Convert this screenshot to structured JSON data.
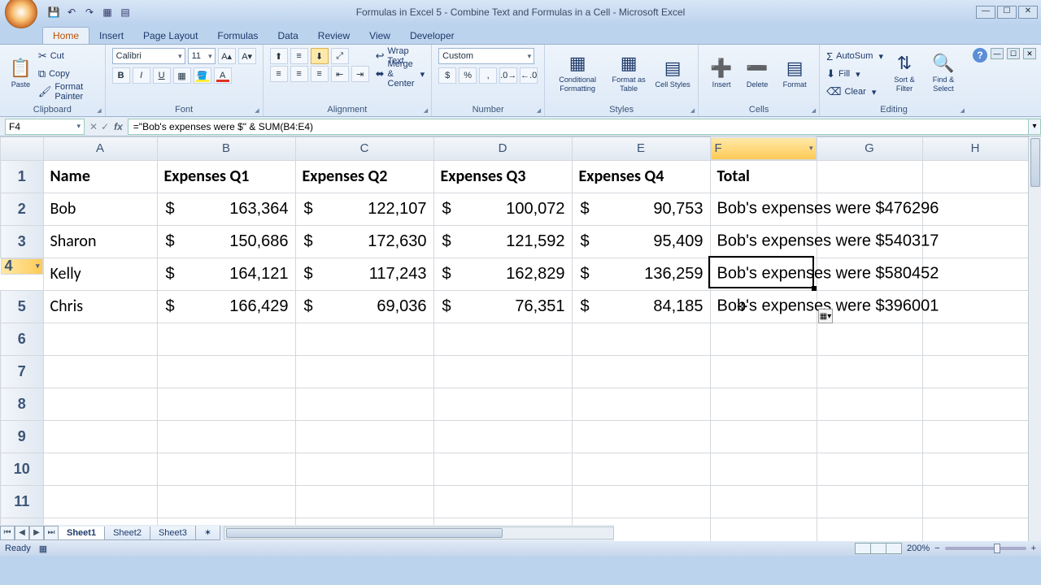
{
  "window": {
    "title": "Formulas in Excel 5 - Combine Text and Formulas in a Cell - Microsoft Excel"
  },
  "tabs": {
    "t0": "Home",
    "t1": "Insert",
    "t2": "Page Layout",
    "t3": "Formulas",
    "t4": "Data",
    "t5": "Review",
    "t6": "View",
    "t7": "Developer"
  },
  "ribbon": {
    "clipboard": {
      "paste": "Paste",
      "cut": "Cut",
      "copy": "Copy",
      "fmt": "Format Painter",
      "label": "Clipboard"
    },
    "font": {
      "name": "Calibri",
      "size": "11",
      "label": "Font"
    },
    "alignment": {
      "wrap": "Wrap Text",
      "merge": "Merge & Center",
      "label": "Alignment"
    },
    "number": {
      "format": "Custom",
      "label": "Number"
    },
    "styles": {
      "cond": "Conditional Formatting",
      "table": "Format as Table",
      "cell": "Cell Styles",
      "label": "Styles"
    },
    "cells": {
      "insert": "Insert",
      "delete": "Delete",
      "format": "Format",
      "label": "Cells"
    },
    "editing": {
      "sum": "AutoSum",
      "fill": "Fill",
      "clear": "Clear",
      "sort": "Sort & Filter",
      "find": "Find & Select",
      "label": "Editing"
    }
  },
  "formulaBar": {
    "cellRef": "F4",
    "formula": "=\"Bob's expenses were $\" & SUM(B4:E4)"
  },
  "columns": {
    "A": "A",
    "B": "B",
    "C": "C",
    "D": "D",
    "E": "E",
    "F": "F",
    "G": "G",
    "H": "H"
  },
  "headers": {
    "name": "Name",
    "q1": "Expenses Q1",
    "q2": "Expenses Q2",
    "q3": "Expenses Q3",
    "q4": "Expenses Q4",
    "total": "Total"
  },
  "rows": [
    {
      "name": "Bob",
      "q1": "163,364",
      "q2": "122,107",
      "q3": "100,072",
      "q4": "90,753",
      "total": "Bob's expenses were $476296"
    },
    {
      "name": "Sharon",
      "q1": "150,686",
      "q2": "172,630",
      "q3": "121,592",
      "q4": "95,409",
      "total": "Bob's expenses were $540317"
    },
    {
      "name": "Kelly",
      "q1": "164,121",
      "q2": "117,243",
      "q3": "162,829",
      "q4": "136,259",
      "total": "Bob's expenses were $580452"
    },
    {
      "name": "Chris",
      "q1": "166,429",
      "q2": "69,036",
      "q3": "76,351",
      "q4": "84,185",
      "total": "Bob's expenses were $396001"
    }
  ],
  "sheets": {
    "s1": "Sheet1",
    "s2": "Sheet2",
    "s3": "Sheet3"
  },
  "status": {
    "ready": "Ready",
    "zoom": "200%"
  },
  "colWidths": {
    "A": 140,
    "B": 170,
    "C": 170,
    "D": 170,
    "E": 170,
    "F": 130,
    "G": 130,
    "H": 130
  }
}
